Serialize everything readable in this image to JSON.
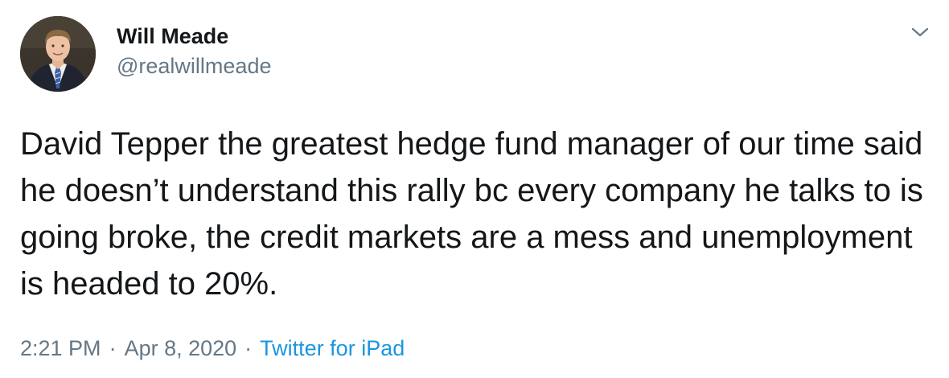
{
  "author": {
    "display_name": "Will Meade",
    "username": "@realwillmeade",
    "avatar_icon": "profile-photo"
  },
  "tweet": {
    "text": "David Tepper the greatest hedge fund manager of our time said he doesn’t understand this rally bc every company he talks to is going broke, the credit markets are a mess and unemployment is headed to 20%."
  },
  "meta": {
    "time": "2:21 PM",
    "separator": "·",
    "date": "Apr 8, 2020",
    "source": "Twitter for iPad"
  },
  "menu": {
    "icon": "chevron-down-icon"
  },
  "colors": {
    "text_primary": "#14171a",
    "text_secondary": "#657786",
    "link": "#1b95e0",
    "background": "#ffffff"
  }
}
